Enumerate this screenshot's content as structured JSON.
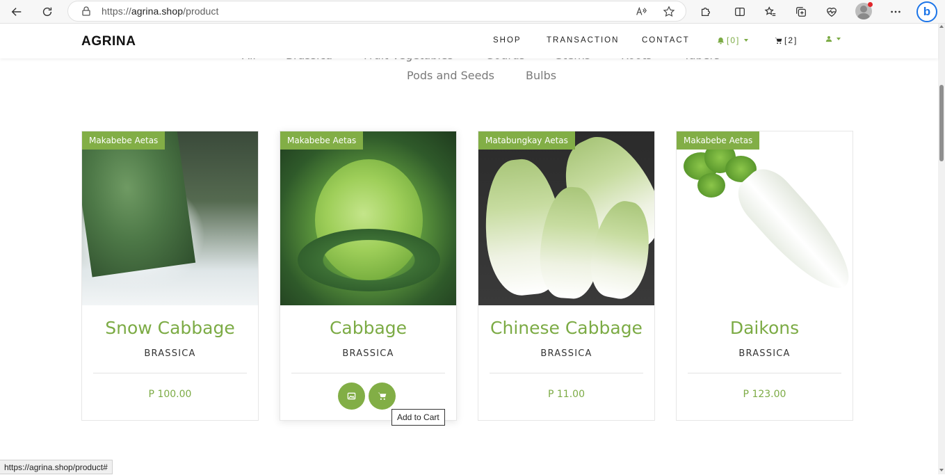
{
  "browser": {
    "url_prefix": "https://",
    "url_host": "agrina.shop",
    "url_path": "/product",
    "status_url": "https://agrina.shop/product#"
  },
  "header": {
    "brand": "AGRINA",
    "nav": {
      "shop": "SHOP",
      "transaction": "TRANSACTION",
      "contact": "CONTACT",
      "notifications": "[0]",
      "cart": "[2]"
    }
  },
  "categories": {
    "row1": [
      "All",
      "Brassica",
      "Fruit Vegetables",
      "Gourds",
      "Stems",
      "Roots",
      "Tubers"
    ],
    "row2": [
      "Pods and Seeds",
      "Bulbs"
    ]
  },
  "products": [
    {
      "seller": "Makabebe Aetas",
      "name": "Snow Cabbage",
      "category": "BRASSICA",
      "price": "P 100.00"
    },
    {
      "seller": "Makabebe Aetas",
      "name": "Cabbage",
      "category": "BRASSICA",
      "price": ""
    },
    {
      "seller": "Matabungkay Aetas",
      "name": "Chinese Cabbage",
      "category": "BRASSICA",
      "price": "P 11.00"
    },
    {
      "seller": "Makabebe Aetas",
      "name": "Daikons",
      "category": "BRASSICA",
      "price": "P 123.00"
    }
  ],
  "tooltip": "Add to Cart",
  "colors": {
    "accent": "#82ae46",
    "accent_text": "#7cab45"
  }
}
